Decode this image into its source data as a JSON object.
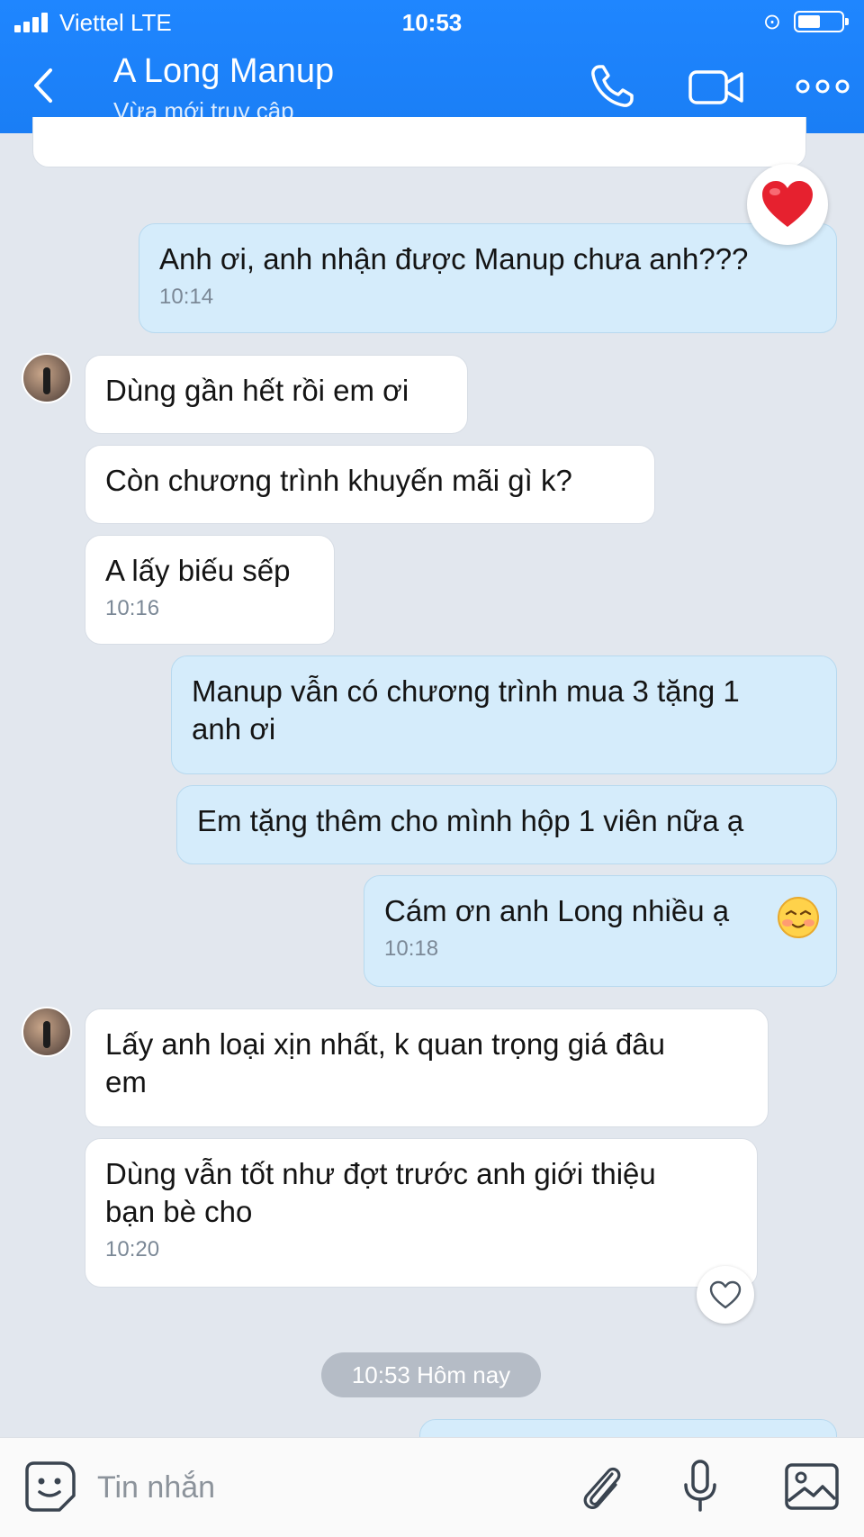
{
  "status_bar": {
    "carrier": "Viettel  LTE",
    "time": "10:53"
  },
  "header": {
    "title": "A Long Manup",
    "subtitle": "Vừa mới truy cập"
  },
  "messages": [
    {
      "dir": "out",
      "text": "Anh ơi, anh nhận được Manup chưa anh???",
      "time": "10:14",
      "reaction": "heart"
    },
    {
      "dir": "in",
      "text": "Dùng gần hết rồi em ơi"
    },
    {
      "dir": "in",
      "text": "Còn chương trình khuyến mãi gì k?"
    },
    {
      "dir": "in",
      "text": "A lấy biếu sếp",
      "time": "10:16"
    },
    {
      "dir": "out",
      "line1": "Manup vẫn có chương trình mua 3 tặng 1",
      "line2": "anh ơi"
    },
    {
      "dir": "out",
      "text": "Em tặng thêm cho mình hộp 1 viên nữa ạ"
    },
    {
      "dir": "out",
      "text": "Cám ơn anh Long nhiều ạ",
      "emoji": "smiling-face-icon",
      "time": "10:18"
    },
    {
      "dir": "in",
      "line1": "Lấy anh loại xịn nhất, k quan trọng giá đâu",
      "line2": "em"
    },
    {
      "dir": "in",
      "line1": "Dùng vẫn tốt như đợt trước anh giới thiệu",
      "line2": "bạn bè cho",
      "time": "10:20"
    }
  ],
  "date_separator": "10:53 Hôm nay",
  "composer": {
    "placeholder": "Tin nhắn"
  },
  "colors": {
    "header": "#1a7ef5",
    "outgoing": "#d5ecfb",
    "incoming": "#ffffff",
    "background": "#e2e7ee"
  }
}
